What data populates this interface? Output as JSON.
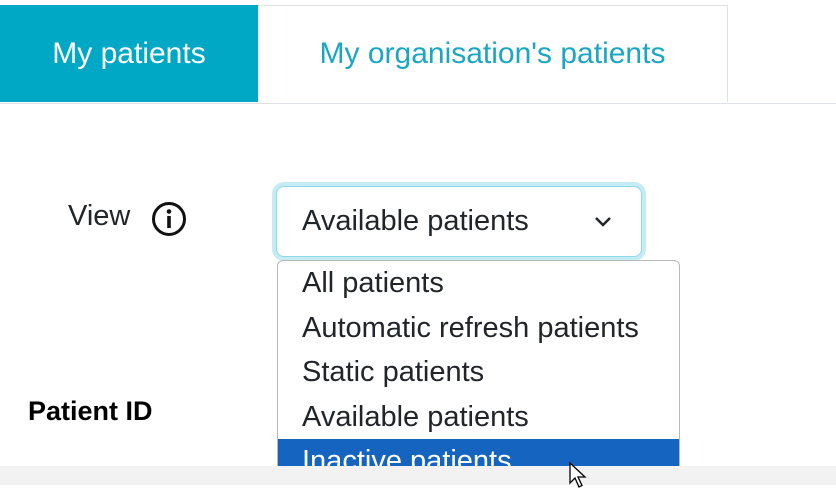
{
  "tabs": [
    {
      "label": "My patients",
      "active": true
    },
    {
      "label": "My organisation's patients",
      "active": false
    }
  ],
  "view": {
    "label": "View",
    "info_icon": "info-circle-icon",
    "selected_value": "Available patients",
    "options": [
      "All patients",
      "Automatic refresh patients",
      "Static patients",
      "Available patients",
      "Inactive patients"
    ],
    "highlighted_option": "Inactive patients"
  },
  "table": {
    "columns": [
      "Patient ID"
    ]
  },
  "colors": {
    "tab_active_bg": "#00a8c6",
    "tab_inactive_text": "#1ba6c4",
    "select_focus_ring": "#c5ecf4",
    "option_highlight": "#1565c0"
  }
}
